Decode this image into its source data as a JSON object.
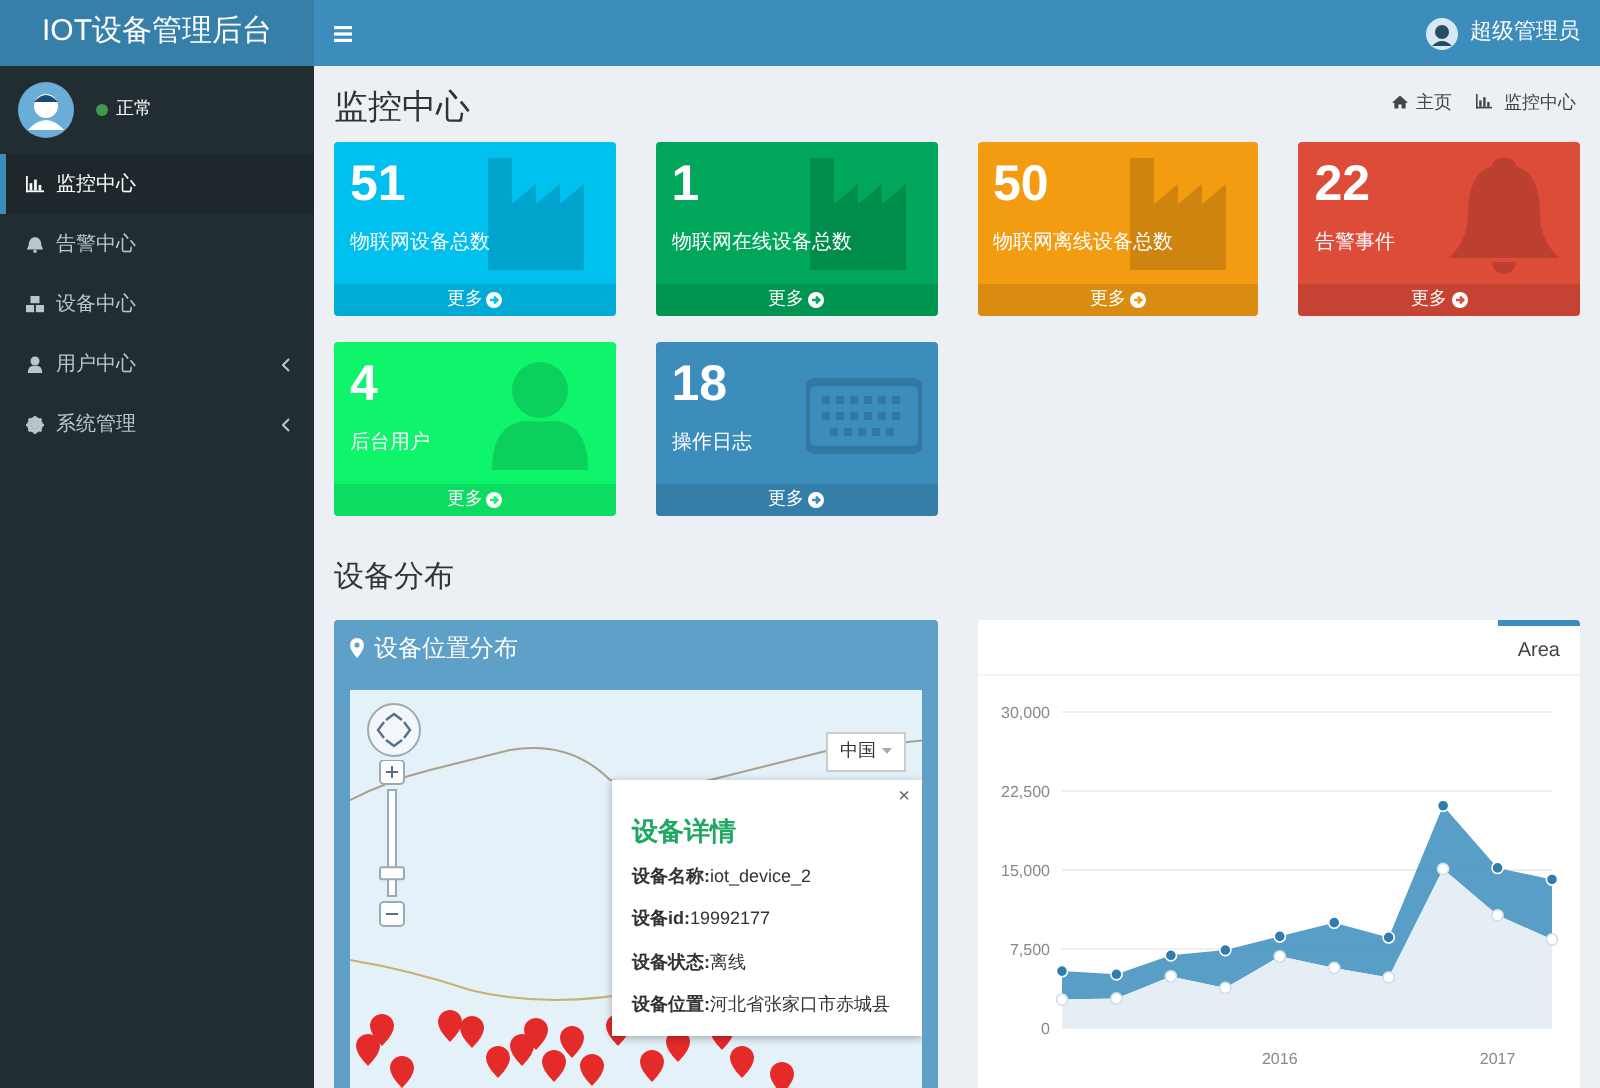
{
  "header": {
    "logo": "IOT设备管理后台",
    "user_name": "超级管理员"
  },
  "sidebar": {
    "user_status": "正常",
    "items": [
      {
        "label": "监控中心",
        "kind": "chart",
        "selected": true,
        "expandable": false
      },
      {
        "label": "告警中心",
        "kind": "bell",
        "selected": false,
        "expandable": false
      },
      {
        "label": "设备中心",
        "kind": "cubes",
        "selected": false,
        "expandable": false
      },
      {
        "label": "用户中心",
        "kind": "user",
        "selected": false,
        "expandable": true
      },
      {
        "label": "系统管理",
        "kind": "gear",
        "selected": false,
        "expandable": true
      }
    ]
  },
  "page": {
    "title": "监控中心",
    "breadcrumb": [
      {
        "label": "主页",
        "kind": "home"
      },
      {
        "label": "监控中心",
        "kind": "chart"
      }
    ]
  },
  "stat_cards": [
    {
      "value": "51",
      "label": "物联网设备总数",
      "link": "更多",
      "color": "#00c0ef",
      "kind": "factory"
    },
    {
      "value": "1",
      "label": "物联网在线设备总数",
      "link": "更多",
      "color": "#00a65a",
      "kind": "factory"
    },
    {
      "value": "50",
      "label": "物联网离线设备总数",
      "link": "更多",
      "color": "#f39c12",
      "kind": "factory"
    },
    {
      "value": "22",
      "label": "告警事件",
      "link": "更多",
      "color": "#dd4b39",
      "kind": "bell"
    },
    {
      "value": "4",
      "label": "后台用户",
      "link": "更多",
      "color": "#0ef56c",
      "kind": "user"
    },
    {
      "value": "18",
      "label": "操作日志",
      "link": "更多",
      "color": "#3c8dbc",
      "kind": "keyboard"
    }
  ],
  "section_title": "设备分布",
  "map_panel": {
    "title": "设备位置分布",
    "region_select": "中国",
    "zoom": {
      "level": 0.2
    },
    "popup": {
      "title": "设备详情",
      "close": "×",
      "lines": [
        "**设备名称:**iot_device_2",
        "**设备id:**19992177",
        "**设备状态:**离线",
        "**设备位置:**河北省张家口市赤城县"
      ]
    }
  },
  "chart_panel": {
    "tabs": [
      {
        "label": "Area",
        "selected": true
      }
    ],
    "chart_data": {
      "type": "area",
      "stacked": true,
      "x": [
        2015,
        2015.25,
        2015.5,
        2015.75,
        2016,
        2016.25,
        2016.5,
        2016.75,
        2017,
        2017.25
      ],
      "grid": true,
      "xlim": [
        2015,
        2017.25
      ],
      "xticks": [
        {
          "value": 2016,
          "label": "2016"
        },
        {
          "value": 2017,
          "label": "2017"
        }
      ],
      "ylim": [
        0,
        30000
      ],
      "yticks": [
        {
          "value": 0,
          "label": "0"
        },
        {
          "value": 7500,
          "label": "7,500"
        },
        {
          "value": 15000,
          "label": "15,000"
        },
        {
          "value": 22500,
          "label": "22,500"
        },
        {
          "value": 30000,
          "label": "30,000"
        }
      ],
      "series": [
        {
          "color": "#e4eef4",
          "values": [
            2700,
            2800,
            4900,
            3800,
            6800,
            5700,
            4800,
            15100,
            10700,
            8400
          ]
        },
        {
          "color": "#3c8dbc",
          "values": [
            2700,
            2300,
            2000,
            3600,
            1900,
            4300,
            3800,
            6000,
            4500,
            5700
          ]
        }
      ]
    }
  }
}
